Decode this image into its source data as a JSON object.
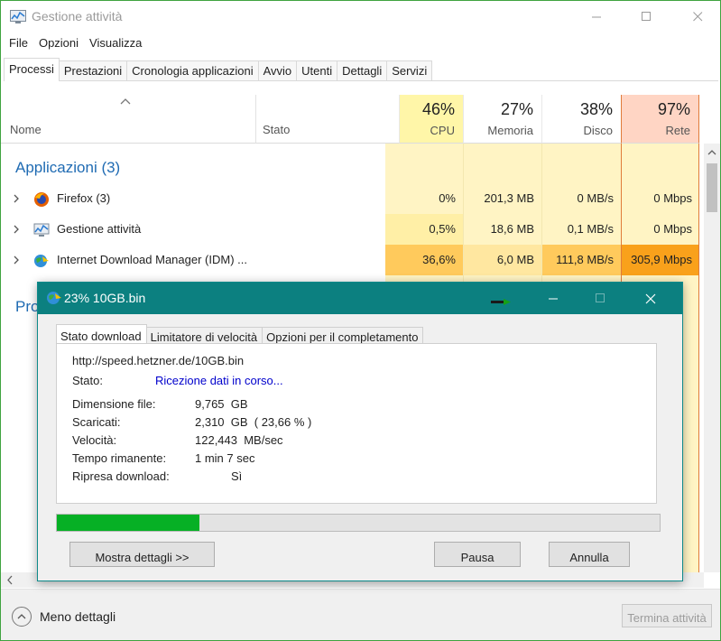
{
  "window": {
    "title": "Gestione attività"
  },
  "menu": [
    "File",
    "Opzioni",
    "Visualizza"
  ],
  "tabs": [
    "Processi",
    "Prestazioni",
    "Cronologia applicazioni",
    "Avvio",
    "Utenti",
    "Dettagli",
    "Servizi"
  ],
  "columns": {
    "name": "Nome",
    "state": "Stato",
    "cpu": {
      "pct": "46%",
      "label": "CPU"
    },
    "memory": {
      "pct": "27%",
      "label": "Memoria"
    },
    "disk": {
      "pct": "38%",
      "label": "Disco"
    },
    "network": {
      "pct": "97%",
      "label": "Rete"
    }
  },
  "group": {
    "title": "Applicazioni (3)",
    "partial_next": "Pro"
  },
  "rows": [
    {
      "name": "Firefox (3)",
      "cpu": "0%",
      "memory": "201,3 MB",
      "disk": "0 MB/s",
      "network": "0 Mbps"
    },
    {
      "name": "Gestione attività",
      "cpu": "0,5%",
      "memory": "18,6 MB",
      "disk": "0,1 MB/s",
      "network": "0 Mbps"
    },
    {
      "name": "Internet Download Manager (IDM) ...",
      "cpu": "36,6%",
      "memory": "6,0 MB",
      "disk": "111,8 MB/s",
      "network": "305,9 Mbps"
    }
  ],
  "footer": {
    "less_details": "Meno dettagli",
    "end_task": "Termina attività"
  },
  "colors": {
    "cpu_header": "#fff6a8",
    "net_header": "#ffd5c4",
    "hot": "#ffca5c",
    "very_hot": "#f9a11b",
    "warm": "#fff4c4",
    "idm_title": "#0c8080",
    "progress": "#06b025"
  },
  "idm": {
    "title": "23% 10GB.bin",
    "tabs": [
      "Stato download",
      "Limitatore di velocità",
      "Opzioni per il completamento"
    ],
    "url": "http://speed.hetzner.de/10GB.bin",
    "status_label": "Stato:",
    "status_value": "Ricezione dati in corso...",
    "fields": [
      {
        "label": "Dimensione file:",
        "value": "9,765  GB"
      },
      {
        "label": "Scaricati:",
        "value": "2,310  GB  ( 23,66 % )"
      },
      {
        "label": "Velocità:",
        "value": "122,443  MB/sec"
      },
      {
        "label": "Tempo rimanente:",
        "value": "1 min 7 sec"
      },
      {
        "label": "Ripresa download:",
        "value": "Sì"
      }
    ],
    "progress_percent": 23.66,
    "buttons": {
      "details": "Mostra dettagli >>",
      "pause": "Pausa",
      "cancel": "Annulla"
    }
  }
}
